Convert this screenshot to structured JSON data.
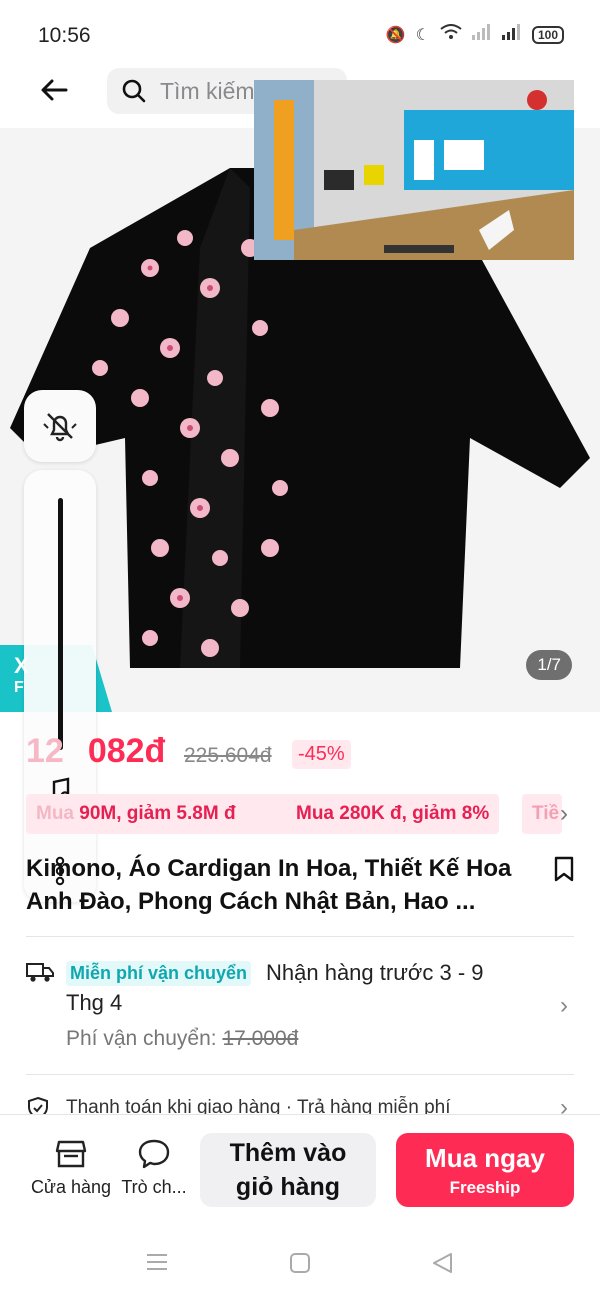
{
  "status_bar": {
    "time": "10:56",
    "battery": "100"
  },
  "header": {
    "search_placeholder": "Tìm kiếm"
  },
  "pip": {
    "label": "video"
  },
  "product": {
    "image_counter": "1/7",
    "promo_tab_text": "X",
    "promo_tab_sub": "F",
    "price_visible": "12",
    "price_tail": "082đ",
    "original_price": "225.604đ",
    "discount": "-45%",
    "chips": [
      "90M, giảm 5.8M đ",
      "Mua 280K đ, giảm 8%",
      "Tiề"
    ],
    "chip_prefix": "Mua",
    "title": "Kimono, Áo Cardigan In Hoa, Thiết Kế Hoa Anh Đào, Phong Cách Nhật Bản, Hao ..."
  },
  "shipping": {
    "badge": "Miễn phí vận chuyển",
    "delivery_1": "Nhận hàng trước 3 - 9",
    "delivery_2": "Thg 4",
    "fee_label": "Phí vận chuyển: ",
    "fee_value": "17.000đ",
    "cod_text": "Thanh toán khi giao hàng · Trả hàng miễn phí"
  },
  "bottom_bar": {
    "shop_label": "Cửa hàng",
    "chat_label": "Trò ch...",
    "add_to_cart_line1": "Thêm vào",
    "add_to_cart_line2": "giỏ hàng",
    "buy_now": "Mua ngay",
    "buy_now_sub": "Freeship"
  },
  "colors": {
    "accent": "#fe2c55",
    "teal": "#19c3c8"
  }
}
